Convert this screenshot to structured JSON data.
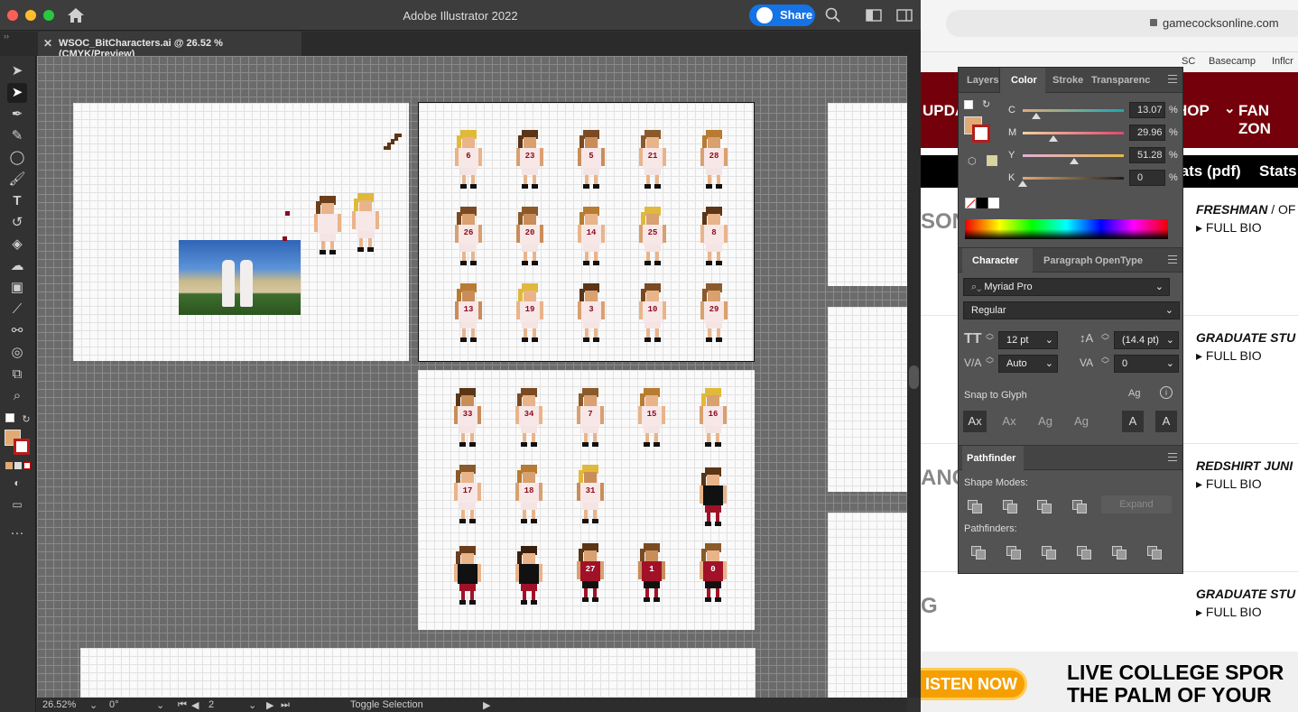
{
  "browser": {
    "url": "gamecocksonline.com",
    "bookmarks": [
      "SC",
      "Basecamp",
      "Inflcr"
    ],
    "header_left": "UPDA",
    "header_shop": "HOP",
    "header_fan": "FAN ZON",
    "nav_text": "tats (pdf)",
    "nav_text2": "Stats",
    "rows": [
      {
        "big": "SON",
        "cls": "FRESHMAN",
        "cls_suffix": " / OF",
        "bio": "FULL BIO"
      },
      {
        "big": "",
        "cls": "GRADUATE STU",
        "cls_suffix": "",
        "bio": "FULL BIO"
      },
      {
        "big": "ANC",
        "cls": "REDSHIRT JUNI",
        "cls_suffix": "",
        "bio": "FULL BIO"
      },
      {
        "big": "G",
        "cls": "GRADUATE STU",
        "cls_suffix": "",
        "bio": "FULL BIO"
      }
    ],
    "listen": "ISTEN NOW",
    "live_line1": "LIVE COLLEGE SPOR",
    "live_line2": "THE PALM OF YOUR"
  },
  "app": {
    "title": "Adobe Illustrator 2022",
    "share_label": "Share",
    "doc_tab": "WSOC_BitCharacters.ai @ 26.52 % (CMYK/Preview)",
    "status": {
      "zoom": "26.52%",
      "rotation": "0°",
      "artboard": "2",
      "tool": "Toggle Selection"
    }
  },
  "players": {
    "row1": [
      "6",
      "23",
      "5",
      "21",
      "28"
    ],
    "row2": [
      "26",
      "20",
      "14",
      "25",
      "8"
    ],
    "row3": [
      "13",
      "19",
      "3",
      "10",
      "29"
    ],
    "row4": [
      "33",
      "34",
      "7",
      "15",
      "16"
    ],
    "row5": [
      "17",
      "18",
      "31"
    ],
    "row6": [
      "27",
      "1",
      "0"
    ]
  },
  "color_panel": {
    "tabs": [
      "Layers",
      "Color",
      "Stroke",
      "Transparenc"
    ],
    "active_tab": "Color",
    "channels": [
      {
        "label": "C",
        "value": "13.07",
        "fraction": 0.1307
      },
      {
        "label": "M",
        "value": "29.96",
        "fraction": 0.2996
      },
      {
        "label": "Y",
        "value": "51.28",
        "fraction": 0.5128
      },
      {
        "label": "K",
        "value": "0",
        "fraction": 0
      }
    ],
    "percent": "%",
    "fill_color": "#e2aa73"
  },
  "character_panel": {
    "tabs": [
      "Character",
      "Paragraph",
      "OpenType"
    ],
    "font_family": "Myriad Pro",
    "font_style": "Regular",
    "size": "12 pt",
    "leading": "(14.4 pt)",
    "kerning": "Auto",
    "tracking": "0",
    "snap_label": "Snap to Glyph"
  },
  "pathfinder_panel": {
    "tab": "Pathfinder",
    "shape_modes_label": "Shape Modes:",
    "expand_label": "Expand",
    "pathfinders_label": "Pathfinders:"
  }
}
